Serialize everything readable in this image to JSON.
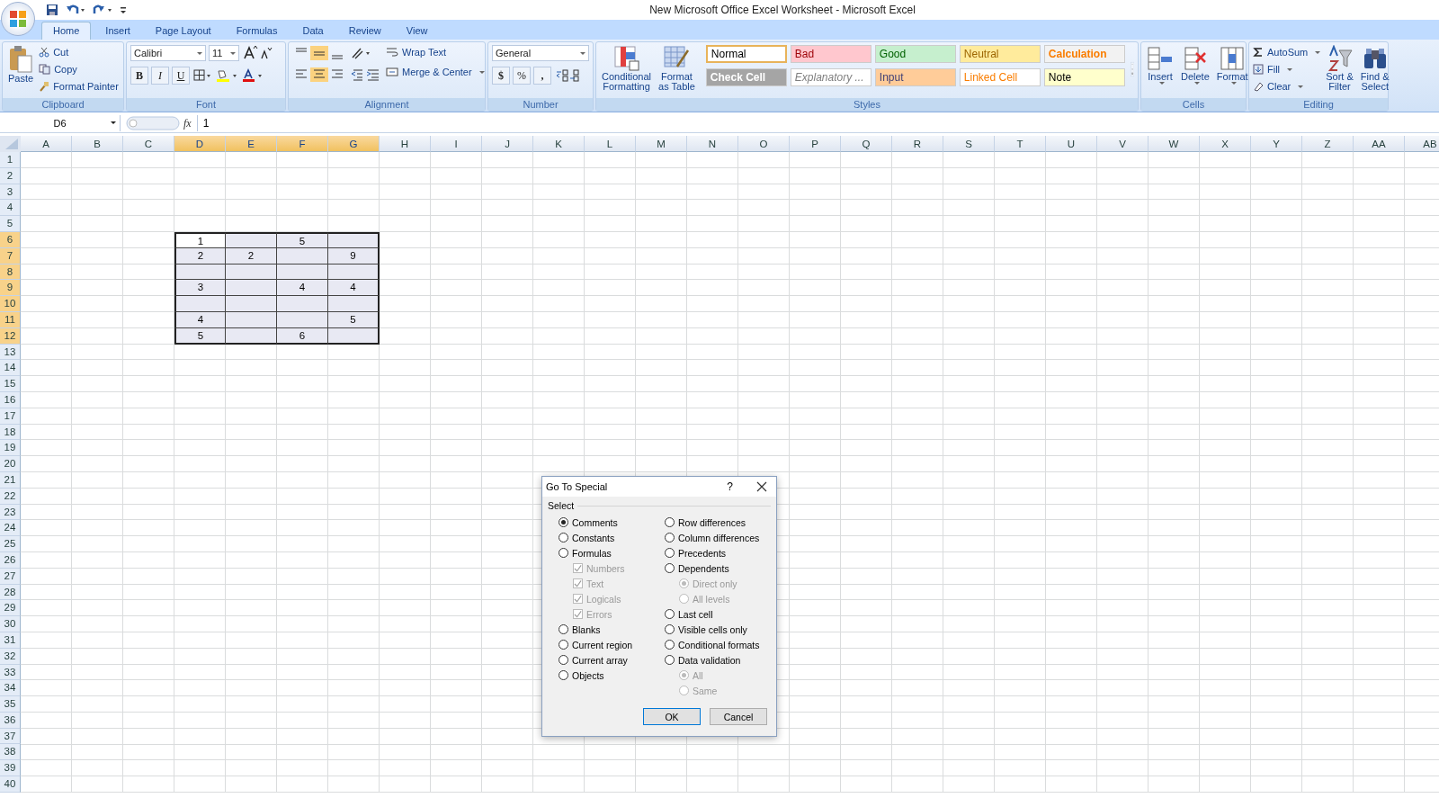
{
  "window": {
    "title": "New Microsoft Office Excel Worksheet - Microsoft Excel"
  },
  "tabs": [
    {
      "label": "Home",
      "selected": true
    },
    {
      "label": "Insert",
      "selected": false
    },
    {
      "label": "Page Layout",
      "selected": false
    },
    {
      "label": "Formulas",
      "selected": false
    },
    {
      "label": "Data",
      "selected": false
    },
    {
      "label": "Review",
      "selected": false
    },
    {
      "label": "View",
      "selected": false
    }
  ],
  "ribbon": {
    "clipboard": {
      "label": "Clipboard",
      "paste": "Paste",
      "cut": "Cut",
      "copy": "Copy",
      "format_painter": "Format Painter"
    },
    "font": {
      "label": "Font",
      "font_name": "Calibri",
      "font_size": "11",
      "bold": "B",
      "italic": "I",
      "underline": "U"
    },
    "alignment": {
      "label": "Alignment",
      "wrap_text": "Wrap Text",
      "merge_center": "Merge & Center"
    },
    "number": {
      "label": "Number",
      "format": "General",
      "currency": "$",
      "percent": "%",
      "comma": ","
    },
    "styles": {
      "label": "Styles",
      "conditional_formatting": [
        "Conditional",
        "Formatting"
      ],
      "format_as_table": [
        "Format",
        "as Table"
      ],
      "cells": [
        {
          "label": "Normal",
          "color": "#000000",
          "fill": {
            "color": "#ffffff"
          },
          "selected": true
        },
        {
          "label": "Bad",
          "color": "#9c0006",
          "fill": {
            "color": "#ffc7ce"
          },
          "selected": false
        },
        {
          "label": "Good",
          "color": "#006100",
          "fill": {
            "color": "#c6efce"
          },
          "selected": false
        },
        {
          "label": "Neutral",
          "color": "#9c6500",
          "fill": {
            "color": "#ffeb9c"
          },
          "selected": false
        },
        {
          "label": "Calculation",
          "color": "#fa7d00",
          "fill": {
            "color": "#f2f2f2"
          },
          "selected": false,
          "bold": true
        },
        {
          "label": "Check Cell",
          "color": "#ffffff",
          "fill": {
            "color": "#a5a5a5"
          },
          "selected": false,
          "bold": true
        },
        {
          "label": "Explanatory ...",
          "color": "#7f7f7f",
          "fill": {
            "color": "#ffffff"
          },
          "selected": false,
          "italic": true
        },
        {
          "label": "Input",
          "color": "#3f3f76",
          "fill": {
            "color": "#ffcc99"
          },
          "selected": false
        },
        {
          "label": "Linked Cell",
          "color": "#fa7d00",
          "fill": {
            "color": "#ffffff"
          },
          "selected": false
        },
        {
          "label": "Note",
          "color": "#000000",
          "fill": {
            "color": "#ffffcc"
          },
          "selected": false
        }
      ]
    },
    "cells": {
      "label": "Cells",
      "insert": "Insert",
      "delete": "Delete",
      "format": "Format"
    },
    "editing": {
      "label": "Editing",
      "autosum": "AutoSum",
      "fill": "Fill",
      "clear": "Clear",
      "sort_filter": [
        "Sort &",
        "Filter"
      ],
      "find_select": [
        "Find &",
        "Select"
      ]
    }
  },
  "formula_bar": {
    "name_box": "D6",
    "function_label": "fx",
    "value": "1"
  },
  "sheet": {
    "columns": [
      {
        "label": "A",
        "selected": false
      },
      {
        "label": "B",
        "selected": false
      },
      {
        "label": "C",
        "selected": false
      },
      {
        "label": "D",
        "selected": true
      },
      {
        "label": "E",
        "selected": true
      },
      {
        "label": "F",
        "selected": true
      },
      {
        "label": "G",
        "selected": true
      },
      {
        "label": "H",
        "selected": false
      },
      {
        "label": "I",
        "selected": false
      },
      {
        "label": "J",
        "selected": false
      },
      {
        "label": "K",
        "selected": false
      },
      {
        "label": "L",
        "selected": false
      },
      {
        "label": "M",
        "selected": false
      },
      {
        "label": "N",
        "selected": false
      },
      {
        "label": "O",
        "selected": false
      },
      {
        "label": "P",
        "selected": false
      },
      {
        "label": "Q",
        "selected": false
      },
      {
        "label": "R",
        "selected": false
      },
      {
        "label": "S",
        "selected": false
      },
      {
        "label": "T",
        "selected": false
      },
      {
        "label": "U",
        "selected": false
      },
      {
        "label": "V",
        "selected": false
      },
      {
        "label": "W",
        "selected": false
      },
      {
        "label": "X",
        "selected": false
      },
      {
        "label": "Y",
        "selected": false
      },
      {
        "label": "Z",
        "selected": false
      },
      {
        "label": "AA",
        "selected": false
      },
      {
        "label": "AB",
        "selected": false
      }
    ],
    "rows": [
      {
        "label": "1",
        "selected": false
      },
      {
        "label": "2",
        "selected": false
      },
      {
        "label": "3",
        "selected": false
      },
      {
        "label": "4",
        "selected": false
      },
      {
        "label": "5",
        "selected": false
      },
      {
        "label": "6",
        "selected": true,
        "cells": [
          {
            "value": "1",
            "active": true
          },
          {
            "active": false
          },
          {
            "value": "5",
            "active": false
          },
          {
            "active": false
          }
        ]
      },
      {
        "label": "7",
        "selected": true,
        "cells": [
          {
            "value": "2",
            "active": false
          },
          {
            "value": "2",
            "active": false
          },
          {
            "active": false
          },
          {
            "value": "9",
            "active": false
          }
        ]
      },
      {
        "label": "8",
        "selected": true,
        "cells": [
          {
            "active": false
          },
          {
            "active": false
          },
          {
            "active": false
          },
          {
            "active": false
          }
        ]
      },
      {
        "label": "9",
        "selected": true,
        "cells": [
          {
            "value": "3",
            "active": false
          },
          {
            "active": false
          },
          {
            "value": "4",
            "active": false
          },
          {
            "value": "4",
            "active": false
          }
        ]
      },
      {
        "label": "10",
        "selected": true,
        "cells": [
          {
            "active": false
          },
          {
            "active": false
          },
          {
            "active": false
          },
          {
            "active": false
          }
        ]
      },
      {
        "label": "11",
        "selected": true,
        "cells": [
          {
            "value": "4",
            "active": false
          },
          {
            "active": false
          },
          {
            "active": false
          },
          {
            "value": "5",
            "active": false
          }
        ]
      },
      {
        "label": "12",
        "selected": true,
        "cells": [
          {
            "value": "5",
            "active": false
          },
          {
            "active": false
          },
          {
            "value": "6",
            "active": false
          },
          {
            "active": false
          }
        ]
      },
      {
        "label": "13",
        "selected": false
      },
      {
        "label": "14",
        "selected": false
      },
      {
        "label": "15",
        "selected": false
      },
      {
        "label": "16",
        "selected": false
      },
      {
        "label": "17",
        "selected": false
      },
      {
        "label": "18",
        "selected": false
      },
      {
        "label": "19",
        "selected": false
      },
      {
        "label": "20",
        "selected": false
      },
      {
        "label": "21",
        "selected": false
      },
      {
        "label": "22",
        "selected": false
      },
      {
        "label": "23",
        "selected": false
      },
      {
        "label": "24",
        "selected": false
      },
      {
        "label": "25",
        "selected": false
      },
      {
        "label": "26",
        "selected": false
      },
      {
        "label": "27",
        "selected": false
      },
      {
        "label": "28",
        "selected": false
      },
      {
        "label": "29",
        "selected": false
      },
      {
        "label": "30",
        "selected": false
      },
      {
        "label": "31",
        "selected": false
      },
      {
        "label": "32",
        "selected": false
      },
      {
        "label": "33",
        "selected": false
      },
      {
        "label": "34",
        "selected": false
      },
      {
        "label": "35",
        "selected": false
      },
      {
        "label": "36",
        "selected": false
      },
      {
        "label": "37",
        "selected": false
      },
      {
        "label": "38",
        "selected": false
      },
      {
        "label": "39",
        "selected": false
      },
      {
        "label": "40",
        "selected": false
      }
    ]
  },
  "dialog": {
    "title": "Go To Special",
    "help": "?",
    "section": "Select",
    "left_options": [
      {
        "label": "Comments",
        "kind": "radio",
        "selected": true,
        "disabled": false
      },
      {
        "label": "Constants",
        "kind": "radio",
        "selected": false,
        "disabled": false
      },
      {
        "label": "Formulas",
        "kind": "radio",
        "selected": false,
        "disabled": false,
        "children": [
          {
            "label": "Numbers",
            "kind": "checkbox",
            "checked": true,
            "disabled": true
          },
          {
            "label": "Text",
            "kind": "checkbox",
            "checked": true,
            "disabled": true
          },
          {
            "label": "Logicals",
            "kind": "checkbox",
            "checked": true,
            "disabled": true
          },
          {
            "label": "Errors",
            "kind": "checkbox",
            "checked": true,
            "disabled": true
          }
        ]
      },
      {
        "label": "Blanks",
        "kind": "radio",
        "selected": false,
        "disabled": false
      },
      {
        "label": "Current region",
        "kind": "radio",
        "selected": false,
        "disabled": false
      },
      {
        "label": "Current array",
        "kind": "radio",
        "selected": false,
        "disabled": false
      },
      {
        "label": "Objects",
        "kind": "radio",
        "selected": false,
        "disabled": false
      }
    ],
    "right_options": [
      {
        "label": "Row differences",
        "kind": "radio",
        "selected": false,
        "disabled": false
      },
      {
        "label": "Column differences",
        "kind": "radio",
        "selected": false,
        "disabled": false
      },
      {
        "label": "Precedents",
        "kind": "radio",
        "selected": false,
        "disabled": false
      },
      {
        "label": "Dependents",
        "kind": "radio",
        "selected": false,
        "disabled": false,
        "children": [
          {
            "label": "Direct only",
            "kind": "radio",
            "selected": true,
            "disabled": true
          },
          {
            "label": "All levels",
            "kind": "radio",
            "selected": false,
            "disabled": true
          }
        ]
      },
      {
        "label": "Last cell",
        "kind": "radio",
        "selected": false,
        "disabled": false
      },
      {
        "label": "Visible cells only",
        "kind": "radio",
        "selected": false,
        "disabled": false
      },
      {
        "label": "Conditional formats",
        "kind": "radio",
        "selected": false,
        "disabled": false
      },
      {
        "label": "Data validation",
        "kind": "radio",
        "selected": false,
        "disabled": false,
        "children": [
          {
            "label": "All",
            "kind": "radio",
            "selected": true,
            "disabled": true
          },
          {
            "label": "Same",
            "kind": "radio",
            "selected": false,
            "disabled": true
          }
        ]
      }
    ],
    "buttons": [
      {
        "label": "OK",
        "kind": "default"
      },
      {
        "label": "Cancel",
        "kind": "normal"
      }
    ]
  }
}
